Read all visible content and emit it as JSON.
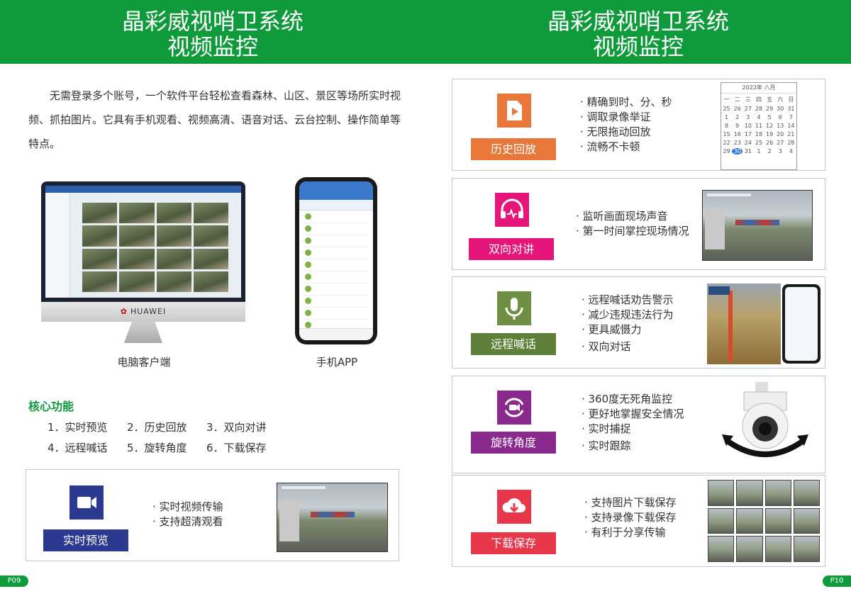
{
  "left_page": {
    "header_line1": "晶彩威视哨卫系统",
    "header_line2": "视频监控",
    "intro": "无需登录多个账号，一个软件平台轻松查看森林、山区、景区等场所实时视频、抓拍图片。它具有手机观看、视频高清、语音对话、云台控制、操作简单等特点。",
    "monitor_brand": "HUAWEI",
    "caption_pc": "电脑客户端",
    "caption_app": "手机APP",
    "section_title": "核心功能",
    "features": [
      "1．实时预览",
      "2．历史回放",
      "3．双向对讲",
      "4．远程喊话",
      "5．旋转角度",
      "6．下载保存"
    ],
    "realtime_card": {
      "label": "实时预览",
      "label_color": "#2b3990",
      "icon": "video-camera-icon",
      "icon_color": "#2b3990",
      "bullets": [
        "实时视频传输",
        "支持超清观看"
      ]
    },
    "page_number": "P09"
  },
  "right_page": {
    "header_line1": "晶彩威视哨卫系统",
    "header_line2": "视频监控",
    "cards": [
      {
        "label": "历史回放",
        "label_color": "#e8783a",
        "icon": "play-file-icon",
        "icon_color": "#e8783a",
        "bullets": [
          "精确到时、分、秒",
          "调取录像举证",
          "无限拖动回放",
          "流畅不卡顿"
        ]
      },
      {
        "label": "双向对讲",
        "label_color": "#e5157a",
        "icon": "headset-icon",
        "icon_color": "#e5157a",
        "bullets": [
          "监听画面现场声音",
          "第一时间掌控现场情况"
        ]
      },
      {
        "label": "远程喊话",
        "label_color": "#5f7f3a",
        "icon": "microphone-icon",
        "icon_color": "#6f8f45",
        "bullets": [
          "远程喊话劝告警示",
          "减少违规违法行为",
          "更具威慑力",
          "双向对话"
        ]
      },
      {
        "label": "旋转角度",
        "label_color": "#8a2a8f",
        "icon": "rotate-camera-icon",
        "icon_color": "#8a2a8f",
        "bullets": [
          "360度无死角监控",
          "更好地掌握安全情况",
          "实时捕捉",
          "实时跟踪"
        ]
      },
      {
        "label": "下载保存",
        "label_color": "#e8364a",
        "icon": "cloud-download-icon",
        "icon_color": "#e8364a",
        "bullets": [
          "支持图片下载保存",
          "支持录像下载保存",
          "有利于分享传输"
        ]
      }
    ],
    "calendar": {
      "title": "2022年 八月",
      "weekdays": [
        "一",
        "二",
        "三",
        "四",
        "五",
        "六",
        "日"
      ],
      "days": [
        "25",
        "26",
        "27",
        "28",
        "29",
        "30",
        "31",
        "1",
        "2",
        "3",
        "4",
        "5",
        "6",
        "7",
        "8",
        "9",
        "10",
        "11",
        "12",
        "13",
        "14",
        "15",
        "16",
        "17",
        "18",
        "19",
        "20",
        "21",
        "22",
        "23",
        "24",
        "25",
        "26",
        "27",
        "28",
        "29",
        "30",
        "31",
        "1",
        "2",
        "3",
        "4"
      ],
      "selected": "30"
    },
    "page_number": "P10"
  }
}
